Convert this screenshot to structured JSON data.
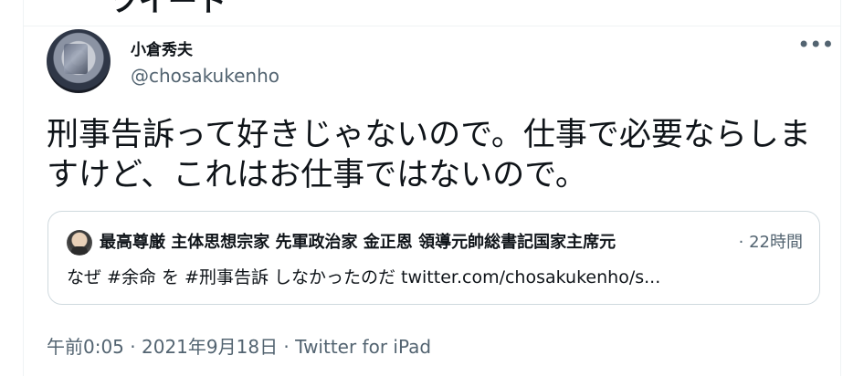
{
  "top": {
    "partial_heading": "ツイート"
  },
  "author": {
    "name": "小倉秀夫",
    "handle": "@chosakukenho"
  },
  "more_menu": {
    "icon": "more-horizontal-icon",
    "label": "•••"
  },
  "tweet": {
    "text": "刑事告訴って好きじゃないので。仕事で必要ならしますけど、これはお仕事ではないので。"
  },
  "quote": {
    "author_name": "最高尊厳 主体思想宗家 先軍政治家 金正恩 領導元帥総書記国家主席元",
    "separator": "·",
    "time": "22時間",
    "text": "なぜ #余命 を #刑事告訴 しなかったのだ twitter.com/chosakukenho/s..."
  },
  "meta": {
    "time": "午前0:05",
    "dot1": " · ",
    "date": "2021年9月18日",
    "dot2": " · ",
    "source": "Twitter for iPad"
  }
}
